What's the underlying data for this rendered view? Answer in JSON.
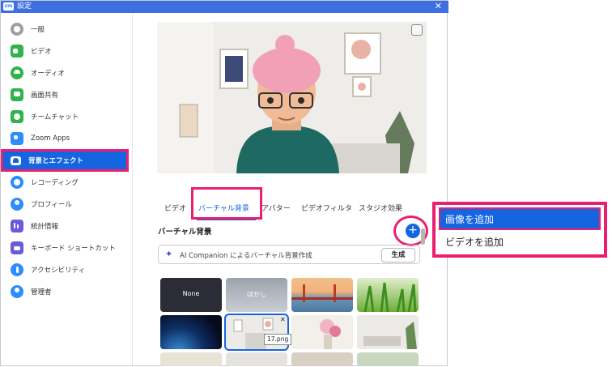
{
  "window": {
    "title": "設定",
    "logo": "zm"
  },
  "sidebar": {
    "items": [
      {
        "label": "一般",
        "icon": "gear-icon",
        "color": "#9aa0a6"
      },
      {
        "label": "ビデオ",
        "icon": "video-icon",
        "color": "#2fb34a"
      },
      {
        "label": "オーディオ",
        "icon": "headphones-icon",
        "color": "#2fb34a"
      },
      {
        "label": "画面共有",
        "icon": "share-screen-icon",
        "color": "#2fb34a"
      },
      {
        "label": "チームチャット",
        "icon": "chat-icon",
        "color": "#2fb34a"
      },
      {
        "label": "Zoom Apps",
        "icon": "apps-icon",
        "color": "#2d8cff"
      },
      {
        "label": "背景とエフェクト",
        "icon": "background-icon",
        "color": "#1565e0"
      },
      {
        "label": "レコーディング",
        "icon": "record-icon",
        "color": "#2d8cff"
      },
      {
        "label": "プロフィール",
        "icon": "profile-icon",
        "color": "#2d8cff"
      },
      {
        "label": "統計情報",
        "icon": "statistics-icon",
        "color": "#6a5cd8"
      },
      {
        "label": "キーボード ショートカット",
        "icon": "keyboard-icon",
        "color": "#6a5cd8"
      },
      {
        "label": "アクセシビリティ",
        "icon": "accessibility-icon",
        "color": "#2d8cff"
      },
      {
        "label": "管理者",
        "icon": "admin-icon",
        "color": "#2d8cff"
      }
    ]
  },
  "tabs": [
    "ビデオ",
    "バーチャル背景",
    "アバター",
    "ビデオフィルタ",
    "スタジオ効果"
  ],
  "section": {
    "title": "バーチャル背景"
  },
  "ai": {
    "placeholder": "AI Companion によるバーチャル背景作成",
    "button": "生成"
  },
  "thumbnails": [
    {
      "caption": "None",
      "icon": "none-thumbnail"
    },
    {
      "caption": "ぼかし",
      "icon": "blur-thumbnail"
    },
    {
      "caption": "",
      "icon": "golden-gate-bridge-thumbnail"
    },
    {
      "caption": "",
      "icon": "grass-thumbnail"
    },
    {
      "caption": "",
      "icon": "earth-from-space-thumbnail"
    },
    {
      "caption": "",
      "icon": "room-thumbnail"
    },
    {
      "caption": "",
      "icon": "flowers-thumbnail"
    },
    {
      "caption": "",
      "icon": "living-room-thumbnail"
    }
  ],
  "tooltip": "17.png",
  "popup": {
    "add_image": "画像を追加",
    "add_video": "ビデオを追加"
  },
  "colors": {
    "accent": "#1565e0",
    "highlight": "#ec1e6f"
  }
}
